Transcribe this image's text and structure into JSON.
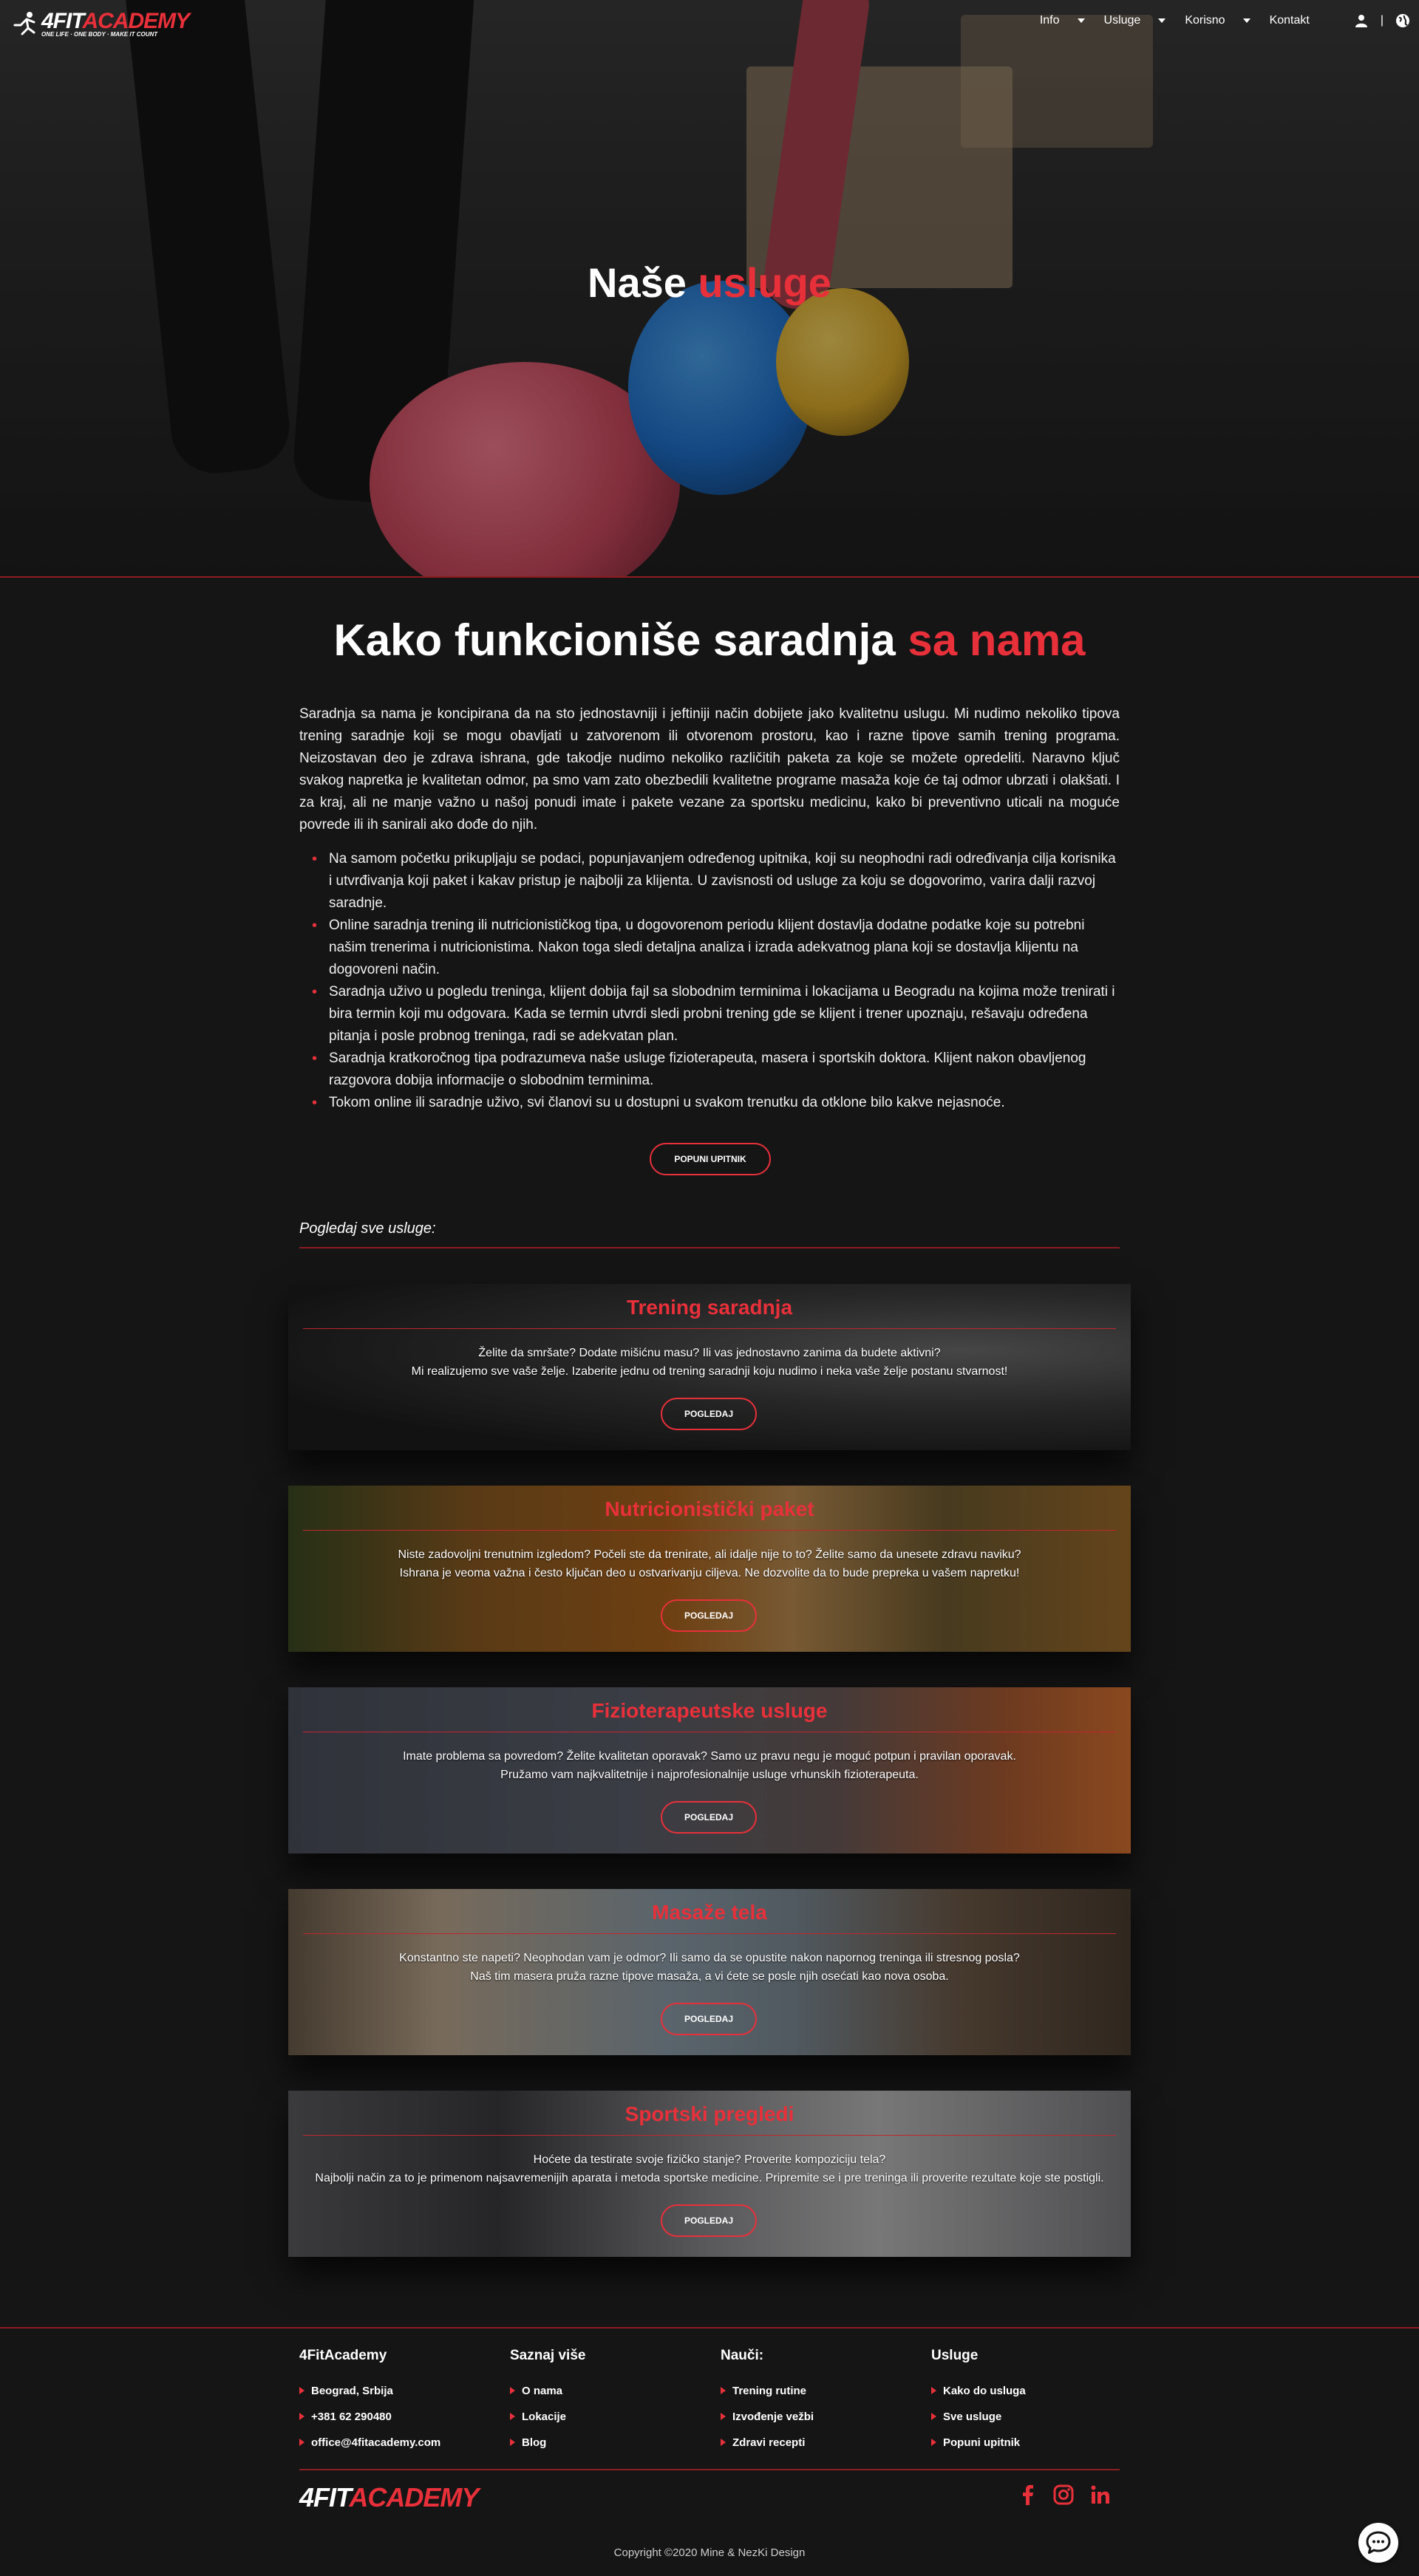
{
  "nav": {
    "brand_part1": "4FIT",
    "brand_part2": "ACADEMY",
    "tagline": "ONE LIFE · ONE BODY · MAKE IT COUNT",
    "items": [
      {
        "label": "Info",
        "has_dropdown": true
      },
      {
        "label": "Usluge",
        "has_dropdown": true
      },
      {
        "label": "Korisno",
        "has_dropdown": true
      },
      {
        "label": "Kontakt",
        "has_dropdown": false
      }
    ],
    "user_icon": "user-icon",
    "language_icon": "globe-icon",
    "separator": "|"
  },
  "hero": {
    "title_part1": "Naše",
    "title_part2": "usluge"
  },
  "cooperation": {
    "title_part1": "Kako funkcioniše saradnja",
    "title_part2": "sa nama",
    "intro": "Saradnja sa nama je koncipirana da na sto jednostavniji i jeftiniji način dobijete jako kvalitetnu uslugu. Mi nudimo nekoliko tipova trening saradnje koji se mogu obavljati u zatvorenom ili otvorenom prostoru, kao i razne tipove samih trening programa. Neizostavan deo je zdrava ishrana, gde takodje nudimo nekoliko različitih paketa za koje se možete opredeliti. Naravno ključ svakog napretka je kvalitetan odmor, pa smo vam zato obezbedili kvalitetne programe masaža koje će taj odmor ubrzati i olakšati. I za kraj, ali ne manje važno u našoj ponudi imate i pakete vezane za sportsku medicinu, kako bi preventivno uticali na moguće povrede ili ih sanirali ako dođe do njih.",
    "bullets": [
      "Na samom početku prikupljaju se podaci, popunjavanjem određenog upitnika, koji su neophodni radi određivanja cilja korisnika i utvrđivanja koji paket i kakav pristup je najbolji za klijenta. U zavisnosti od usluge za koju se dogovorimo, varira dalji razvoj saradnje.",
      "Online saradnja trening ili nutricionističkog tipa, u dogovorenom periodu klijent dostavlja dodatne podatke koje su potrebni našim trenerima i nutricionistima. Nakon toga sledi detaljna analiza i izrada adekvatnog plana koji se dostavlja klijentu na dogovoreni način.",
      "Saradnja uživo u pogledu treninga, klijent dobija fajl sa slobodnim terminima i lokacijama u Beogradu na kojima može trenirati i bira termin koji mu odgovara. Kada se termin utvrdi sledi probni trening gde se klijent i trener upoznaju, rešavaju određena pitanja i posle probnog treninga, radi se adekvatan plan.",
      "Saradnja kratkoročnog tipa podrazumeva naše usluge fizioterapeuta, masera i sportskih doktora. Klijent nakon obavljenog razgovora dobija informacije o slobodnim terminima.",
      "Tokom online ili saradnje uživo, svi članovi su u dostupni u svakom trenutku da otklone bilo kakve nejasnoće."
    ],
    "button": "POPUNI UPITNIK"
  },
  "services_header": "Pogledaj sve usluge:",
  "services": [
    {
      "title": "Trening saradnja",
      "line1": "Želite da smršate? Dodate mišićnu masu? Ili vas jednostavno zanima da budete aktivni?",
      "line2": "Mi realizujemo sve vaše želje. Izaberite jednu od trening saradnji koju nudimo i neka vaše želje postanu stvarnost!",
      "button": "POGLEDAJ"
    },
    {
      "title": "Nutricionistički paket",
      "line1": "Niste zadovoljni trenutnim izgledom? Počeli ste da trenirate, ali idalje nije to to? Želite samo da unesete zdravu naviku?",
      "line2": "Ishrana je veoma važna i često ključan deo u ostvarivanju ciljeva. Ne dozvolite da to bude prepreka u vašem napretku!",
      "button": "POGLEDAJ"
    },
    {
      "title": "Fizioterapeutske usluge",
      "line1": "Imate problema sa povredom? Želite kvalitetan oporavak? Samo uz pravu negu je moguć potpun i pravilan oporavak.",
      "line2": "Pružamo vam najkvalitetnije i najprofesionalnije usluge vrhunskih fizioterapeuta.",
      "button": "POGLEDAJ"
    },
    {
      "title": "Masaže tela",
      "line1": "Konstantno ste napeti? Neophodan vam je odmor? Ili samo da se opustite nakon napornog treninga ili stresnog posla?",
      "line2": "Naš tim masera pruža razne tipove masaža, a vi ćete se posle njih osećati kao nova osoba.",
      "button": "POGLEDAJ"
    },
    {
      "title": "Sportski pregledi",
      "line1": "Hoćete da testirate svoje fizičko stanje? Proverite kompoziciju tela?",
      "line2": "Najbolji način za to je primenom najsavremenijih aparata i metoda sportske medicine. Pripremite se i pre treninga ili proverite rezultate koje ste postigli.",
      "button": "POGLEDAJ"
    }
  ],
  "footer": {
    "columns": [
      {
        "title": "4FitAcademy",
        "items": [
          "Beograd, Srbija",
          "+381 62 290480",
          "office@4fitacademy.com"
        ]
      },
      {
        "title": "Saznaj više",
        "items": [
          "O nama",
          "Lokacije",
          "Blog"
        ]
      },
      {
        "title": "Nauči:",
        "items": [
          "Trening rutine",
          "Izvođenje vežbi",
          "Zdravi recepti"
        ]
      },
      {
        "title": "Usluge",
        "items": [
          "Kako do usluga",
          "Sve usluge",
          "Popuni upitnik"
        ]
      }
    ],
    "logo_part1": "4FIT",
    "logo_part2": "ACADEMY",
    "social_icons": [
      "facebook-icon",
      "instagram-icon",
      "linkedin-icon"
    ],
    "copyright": "Copyright ©2020 Mine & NezKi Design"
  },
  "colors": {
    "accent": "#e8303a",
    "background": "#151515",
    "divider": "#8c1c22"
  }
}
